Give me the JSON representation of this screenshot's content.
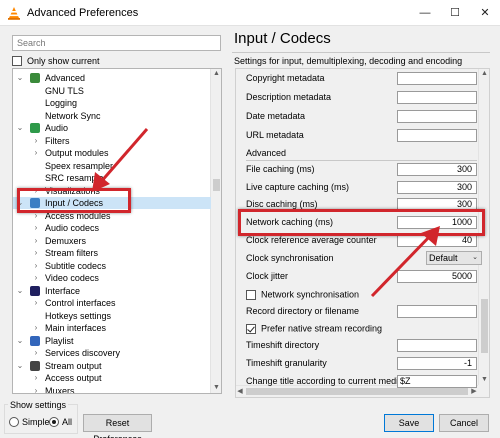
{
  "window": {
    "title": "Advanced Preferences",
    "min_glyph": "—",
    "max_glyph": "☐",
    "close_glyph": "✕"
  },
  "left_panel": {
    "search_placeholder": "Search",
    "only_show_current_label": "Only show current",
    "tree": [
      {
        "label": "Advanced",
        "level": 0,
        "expanded": true,
        "icon": "advanced-icon"
      },
      {
        "label": "GNU TLS",
        "level": 1
      },
      {
        "label": "Logging",
        "level": 1
      },
      {
        "label": "Network Sync",
        "level": 1
      },
      {
        "label": "Audio",
        "level": 0,
        "expanded": true,
        "icon": "audio-icon"
      },
      {
        "label": "Filters",
        "level": 1,
        "collapsed": true
      },
      {
        "label": "Output modules",
        "level": 1,
        "collapsed": true
      },
      {
        "label": "Speex resampler",
        "level": 1
      },
      {
        "label": "SRC resampler",
        "level": 1
      },
      {
        "label": "Visualizations",
        "level": 1,
        "collapsed": true
      },
      {
        "label": "Input / Codecs",
        "level": 0,
        "expanded": true,
        "icon": "input-codecs-icon",
        "selected": true
      },
      {
        "label": "Access modules",
        "level": 1,
        "collapsed": true
      },
      {
        "label": "Audio codecs",
        "level": 1,
        "collapsed": true
      },
      {
        "label": "Demuxers",
        "level": 1,
        "collapsed": true
      },
      {
        "label": "Stream filters",
        "level": 1,
        "collapsed": true
      },
      {
        "label": "Subtitle codecs",
        "level": 1,
        "collapsed": true
      },
      {
        "label": "Video codecs",
        "level": 1,
        "collapsed": true
      },
      {
        "label": "Interface",
        "level": 0,
        "expanded": true,
        "icon": "interface-icon"
      },
      {
        "label": "Control interfaces",
        "level": 1,
        "collapsed": true
      },
      {
        "label": "Hotkeys settings",
        "level": 1
      },
      {
        "label": "Main interfaces",
        "level": 1,
        "collapsed": true
      },
      {
        "label": "Playlist",
        "level": 0,
        "expanded": true,
        "icon": "playlist-icon"
      },
      {
        "label": "Services discovery",
        "level": 1,
        "collapsed": true
      },
      {
        "label": "Stream output",
        "level": 0,
        "expanded": true,
        "icon": "stream-output-icon"
      },
      {
        "label": "Access output",
        "level": 1,
        "collapsed": true
      },
      {
        "label": "Muxers",
        "level": 1,
        "collapsed": true
      }
    ],
    "show_settings": {
      "legend": "Show settings",
      "simple_label": "Simple",
      "all_label": "All",
      "selected": "All"
    },
    "reset_button": "Reset Preferences"
  },
  "right_panel": {
    "title": "Input / Codecs",
    "subtitle": "Settings for input, demultiplexing, decoding and encoding",
    "rows_top": [
      {
        "label": "Copyright metadata",
        "value": ""
      },
      {
        "label": "Description metadata",
        "value": ""
      },
      {
        "label": "Date metadata",
        "value": ""
      },
      {
        "label": "URL metadata",
        "value": ""
      }
    ],
    "section_advanced": "Advanced",
    "rows_advanced": [
      {
        "label": "File caching (ms)",
        "value": "300"
      },
      {
        "label": "Live capture caching (ms)",
        "value": "300"
      },
      {
        "label": "Disc caching (ms)",
        "value": "300"
      },
      {
        "label": "Network caching (ms)",
        "value": "1000"
      },
      {
        "label": "Clock reference average counter",
        "value": "40"
      },
      {
        "label": "Clock synchronisation",
        "value": "Default"
      },
      {
        "label": "Clock jitter",
        "value": "5000"
      },
      {
        "label": "Network synchronisation",
        "checked": false
      },
      {
        "label": "Record directory or filename",
        "value": ""
      },
      {
        "label": "Prefer native stream recording",
        "checked": true
      },
      {
        "label": "Timeshift directory",
        "value": ""
      },
      {
        "label": "Timeshift granularity",
        "value": "-1"
      },
      {
        "label": "Change title according to current media",
        "value": "$Z"
      }
    ]
  },
  "footer": {
    "save_label": "Save",
    "cancel_label": "Cancel"
  },
  "annotations": {
    "highlight_color": "#d1262c"
  }
}
